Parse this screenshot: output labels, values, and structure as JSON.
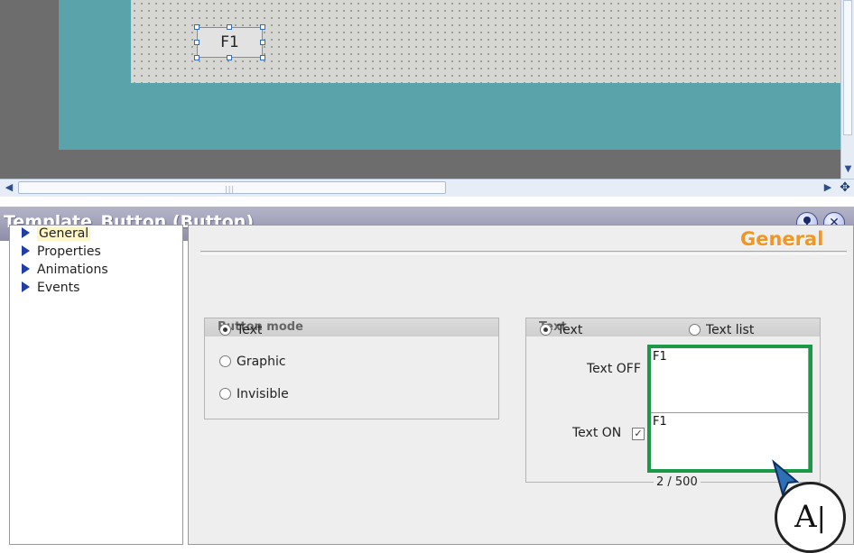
{
  "canvas": {
    "selected_button_label": "F1"
  },
  "inspector": {
    "title": "Template_Button (Button)",
    "nav_items": [
      {
        "label": "General",
        "selected": true
      },
      {
        "label": "Properties",
        "selected": false
      },
      {
        "label": "Animations",
        "selected": false
      },
      {
        "label": "Events",
        "selected": false
      }
    ],
    "section_heading": "General",
    "button_mode": {
      "title": "Button mode",
      "options": [
        "Text",
        "Graphic",
        "Invisible"
      ],
      "selected": "Text"
    },
    "text_group": {
      "title": "Text",
      "options": [
        "Text",
        "Text list"
      ],
      "selected": "Text",
      "text_off_label": "Text OFF",
      "text_off_value": "F1",
      "text_on_label": "Text ON",
      "text_on_checked": true,
      "check_mark": "✓",
      "text_on_value": "F1",
      "char_counter": "2 / 500"
    },
    "cursor_badge_text": "A"
  },
  "colors": {
    "accent_heading": "#f19624",
    "highlight_frame": "#1a9a47",
    "title_bar": "#9d9db6",
    "canvas_teal": "#5aa3ab",
    "nav_arrow": "#1f3fa8"
  },
  "icons": {
    "pin": "pin-icon",
    "close": "close-icon",
    "scroll_left": "arrow-left-icon",
    "scroll_right": "arrow-right-icon",
    "scroll_down": "arrow-down-icon",
    "move": "move-icon",
    "text_cursor": "text-cursor-icon"
  }
}
